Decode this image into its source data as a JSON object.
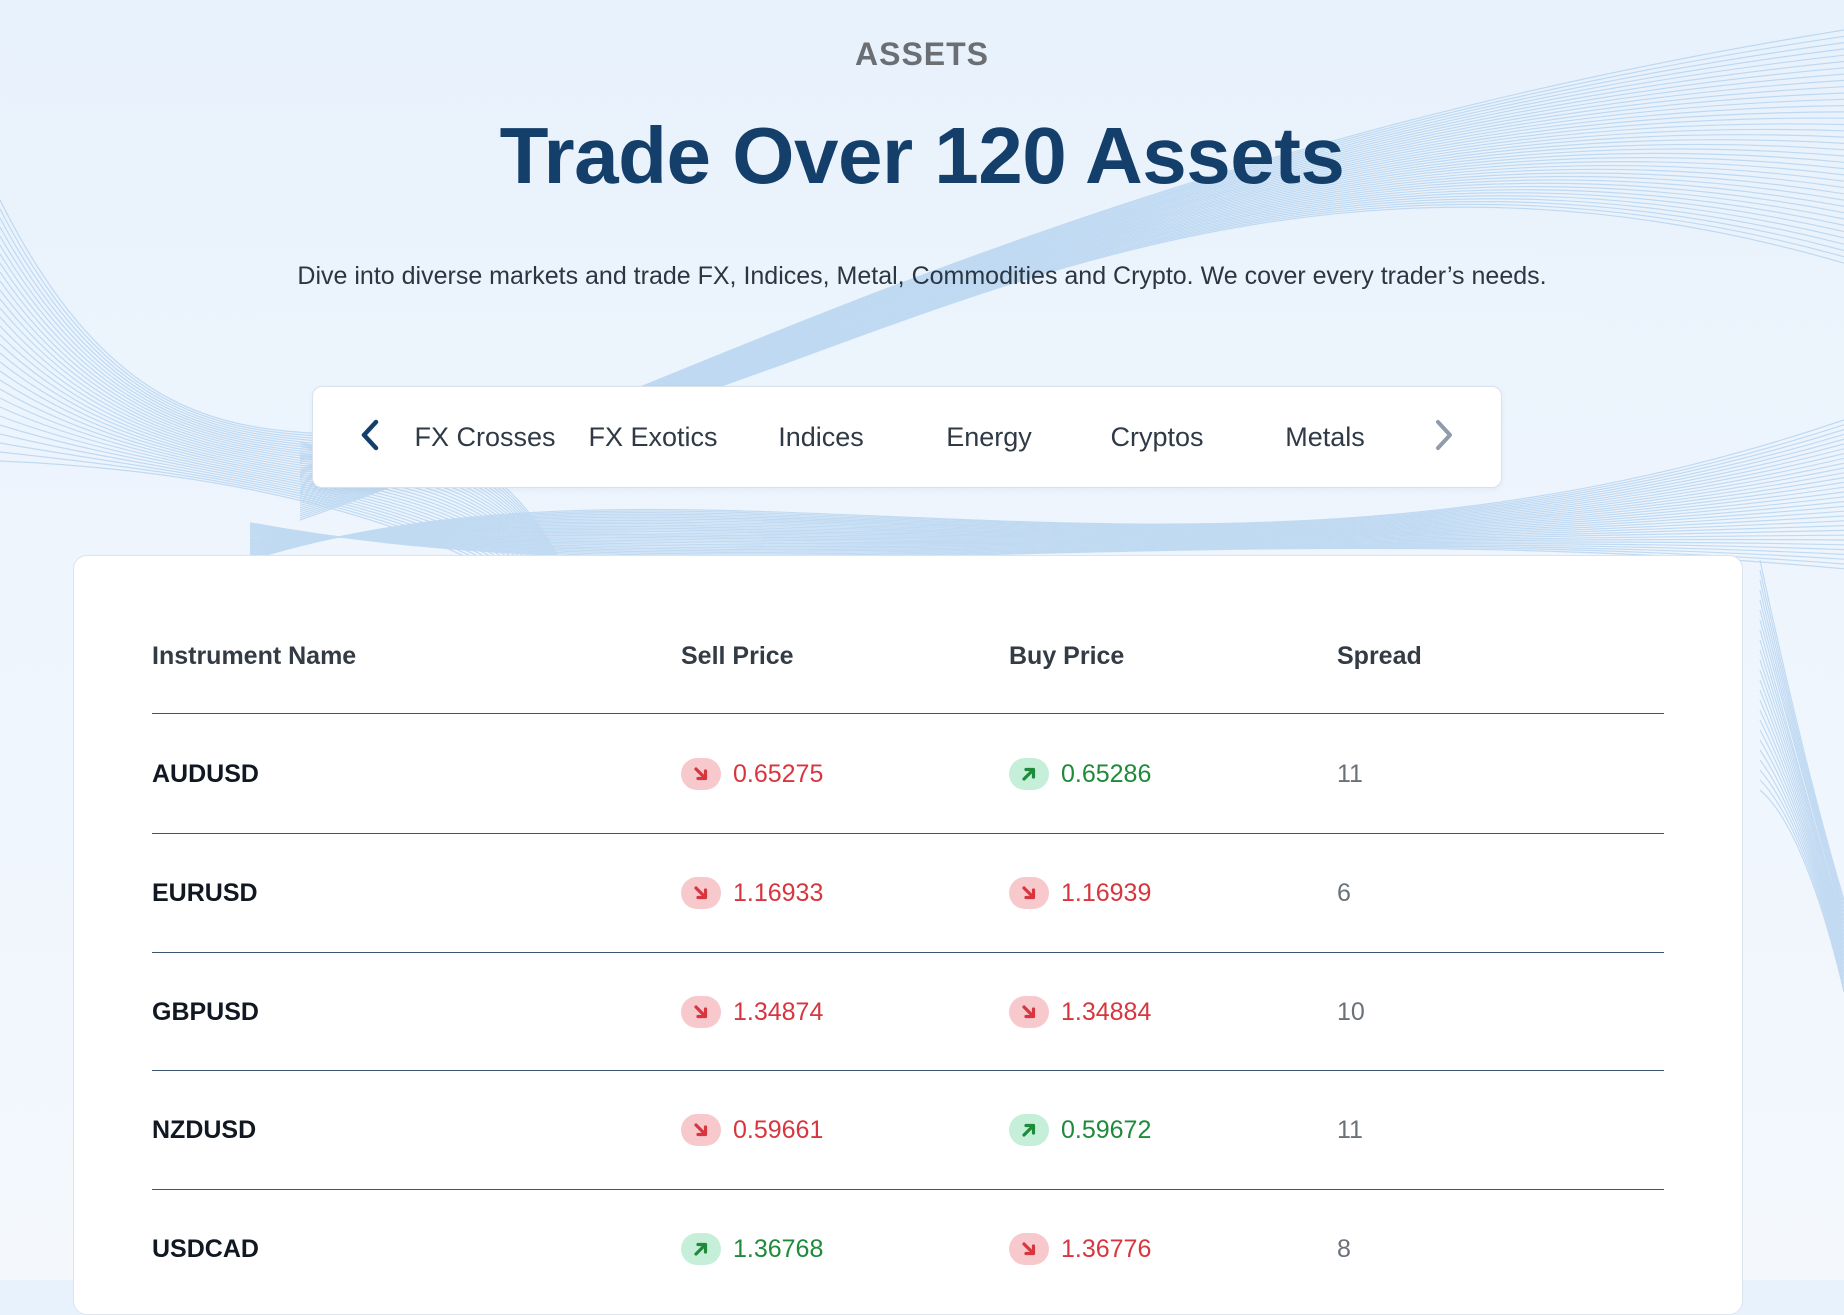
{
  "header": {
    "eyebrow": "ASSETS",
    "title": "Trade Over 120 Assets",
    "subtitle": "Dive into diverse markets and trade FX, Indices, Metal, Commodities and Crypto. We cover every trader’s needs."
  },
  "tabs": {
    "prev_icon": "chevron-left-icon",
    "next_icon": "chevron-right-icon",
    "items": [
      {
        "label": "FX Crosses"
      },
      {
        "label": "FX Exotics"
      },
      {
        "label": "Indices"
      },
      {
        "label": "Energy"
      },
      {
        "label": "Cryptos"
      },
      {
        "label": "Metals"
      }
    ]
  },
  "table": {
    "columns": [
      "Instrument Name",
      "Sell Price",
      "Buy Price",
      "Spread"
    ],
    "rows": [
      {
        "name": "AUDUSD",
        "sell": "0.65275",
        "sell_dir": "down",
        "buy": "0.65286",
        "buy_dir": "up",
        "spread": "11"
      },
      {
        "name": "EURUSD",
        "sell": "1.16933",
        "sell_dir": "down",
        "buy": "1.16939",
        "buy_dir": "down",
        "spread": "6"
      },
      {
        "name": "GBPUSD",
        "sell": "1.34874",
        "sell_dir": "down",
        "buy": "1.34884",
        "buy_dir": "down",
        "spread": "10"
      },
      {
        "name": "NZDUSD",
        "sell": "0.59661",
        "sell_dir": "down",
        "buy": "0.59672",
        "buy_dir": "up",
        "spread": "11"
      },
      {
        "name": "USDCAD",
        "sell": "1.36768",
        "sell_dir": "up",
        "buy": "1.36776",
        "buy_dir": "down",
        "spread": "8"
      }
    ]
  },
  "colors": {
    "title": "#143f6b",
    "down": "#d8363f",
    "up": "#1e8a3a",
    "down_badge": "#f7c9cc",
    "up_badge": "#c5efd9"
  }
}
